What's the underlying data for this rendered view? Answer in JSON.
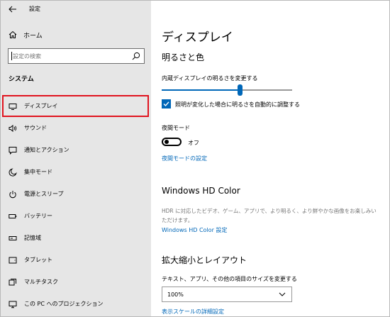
{
  "titlebar": {
    "app_title": "設定",
    "back_icon": "arrow-left-icon",
    "minimize_icon": "minimize-icon",
    "maximize_icon": "maximize-icon",
    "close_icon": "close-icon"
  },
  "sidebar": {
    "home_label": "ホーム",
    "search_placeholder": "設定の検索",
    "section_label": "システム",
    "items": [
      {
        "label": "ディスプレイ",
        "icon": "monitor-icon",
        "selected": true
      },
      {
        "label": "サウンド",
        "icon": "speaker-icon",
        "selected": false
      },
      {
        "label": "通知とアクション",
        "icon": "notification-icon",
        "selected": false
      },
      {
        "label": "集中モード",
        "icon": "moon-icon",
        "selected": false
      },
      {
        "label": "電源とスリープ",
        "icon": "power-icon",
        "selected": false
      },
      {
        "label": "バッテリー",
        "icon": "battery-icon",
        "selected": false
      },
      {
        "label": "記憶域",
        "icon": "storage-icon",
        "selected": false
      },
      {
        "label": "タブレット",
        "icon": "tablet-icon",
        "selected": false
      },
      {
        "label": "マルチタスク",
        "icon": "multitask-icon",
        "selected": false
      },
      {
        "label": "この PC へのプロジェクション",
        "icon": "projection-icon",
        "selected": false
      }
    ]
  },
  "main": {
    "page_title": "ディスプレイ",
    "brightness": {
      "heading": "明るさと色",
      "slider_label": "内蔵ディスプレイの明るさを変更する",
      "slider_value": 0.6,
      "auto_checkbox_label": "照明が変化した場合に明るさを自動的に調整する",
      "auto_checked": true
    },
    "night_light": {
      "label": "夜間モード",
      "toggle_state": "オフ",
      "settings_link": "夜間モードの設定"
    },
    "hdr": {
      "heading": "Windows HD Color",
      "description": "HDR に対応したビデオ、ゲーム、アプリで、より明るく、より鮮やかな画像をお楽しみいただけます。",
      "settings_link": "Windows HD Color 設定"
    },
    "scale": {
      "heading": "拡大縮小とレイアウト",
      "label": "テキスト、アプリ、その他の項目のサイズを変更する",
      "selected_value": "100%",
      "advanced_link": "表示スケールの詳細設定"
    }
  },
  "colors": {
    "accent": "#0067b8",
    "selection_outline": "#e0141f",
    "sidebar_bg": "#e6e6e6"
  }
}
